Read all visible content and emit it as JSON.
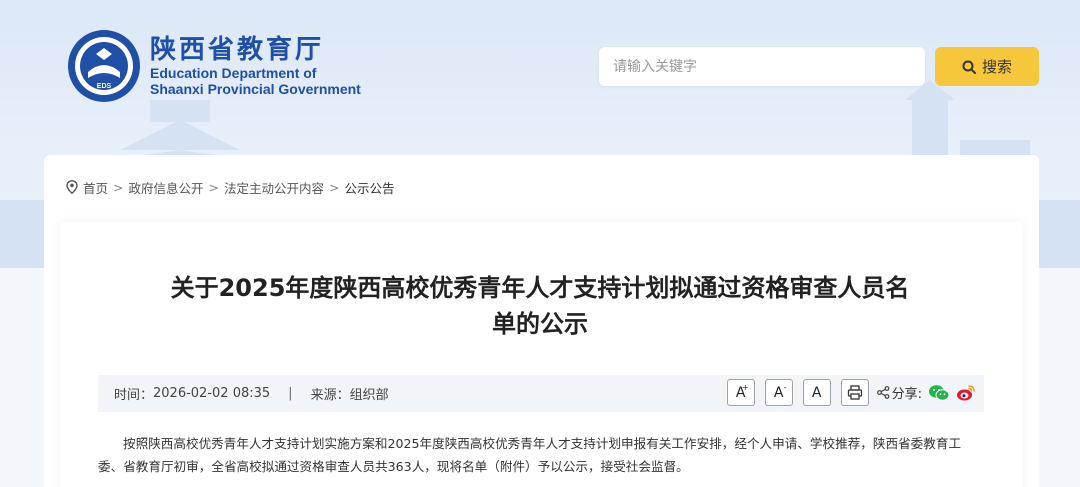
{
  "header": {
    "emblem_text": "EDUCATION DEPARTMENT OF SHAANXI",
    "emblem_code": "EDS",
    "emblem_bottom": "陕西省教育厅",
    "name_cn": "陕西省教育厅",
    "name_en_line1": "Education Department of",
    "name_en_line2": "Shaanxi Provincial Government"
  },
  "search": {
    "placeholder": "请输入关键字",
    "button_label": "搜索"
  },
  "breadcrumb": {
    "items": [
      "首页",
      "政府信息公开",
      "法定主动公开内容",
      "公示公告"
    ],
    "separator": ">"
  },
  "article": {
    "title_line1": "关于2025年度陕西高校优秀青年人才支持计划拟通过资格审查人员名",
    "title_line2": "单的公示",
    "time_label": "时间：",
    "time_value": "2026-02-02 08:35",
    "divider": "|",
    "source_label": "来源：",
    "source_value": "组织部",
    "font_large": "A",
    "font_large_sup": "+",
    "font_small": "A",
    "font_small_sup": "-",
    "font_reset": "A",
    "share_label": "分享:",
    "body": "按照陕西高校优秀青年人才支持计划实施方案和2025年度陕西高校优秀青年人才支持计划申报有关工作安排，经个人申请、学校推荐，陕西省委教育工委、省教育厅初审，全省高校拟通过资格审查人员共363人，现将名单（附件）予以公示，接受社会监督。"
  },
  "colors": {
    "brand_blue": "#1f4fa6",
    "search_yellow": "#f7c73b",
    "wechat_green": "#21b54b",
    "weibo_red": "#e6162d"
  }
}
